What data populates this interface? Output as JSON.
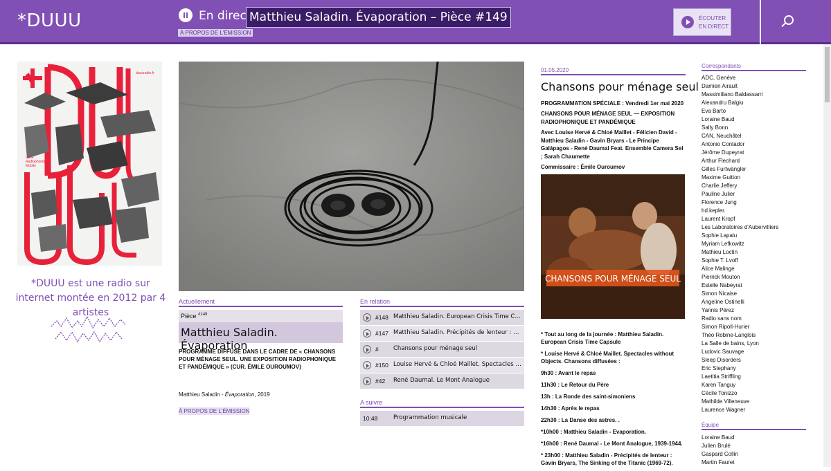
{
  "header": {
    "logo": "*DUUU",
    "live_label": "En direct :",
    "live_title": "Matthieu Saladin. Évaporation – Pièce #149",
    "about_link": "À PROPOS DE L'ÉMISSION",
    "listen_line1": "ÉCOUTER",
    "listen_line2": "EN DIRECT",
    "accent_color": "#8150b4"
  },
  "left": {
    "poster_label": "duuuradio.fr",
    "poster_caption_1": "Unité",
    "poster_caption_2": "Radiophonique",
    "poster_caption_3": "Mobile",
    "tagline": "*DUUU est une radio sur internet montée en 2012 par 4 artistes"
  },
  "current": {
    "section": "Actuellement",
    "piece_label": "Pièce ",
    "piece_number": "#149",
    "title": "Matthieu Saladin. Évaporation",
    "program_text": "PROGRAMME DIFFUSÉ DANS LE CADRE DE « CHANSONS POUR MÉNAGE SEUL. UNE EXPOSITION RADIOPHONIQUE ET PANDÉMIQUE » (CUR. ÉMILE OUROUMOV)",
    "credit_author": "Matthieu Saladin - ",
    "credit_work": "Évaporation",
    "credit_year": ", 2019",
    "about_link": "À PROPOS DE L'ÉMISSION"
  },
  "related": {
    "section": "En relation",
    "items": [
      {
        "num": "#148",
        "title": "Matthieu Saladin. European Crisis Time Capsule"
      },
      {
        "num": "#147",
        "title": "Matthieu Saladin. Précipités de lenteur : Gavin Br..."
      },
      {
        "num": "#",
        "title": "Chansons pour ménage seul"
      },
      {
        "num": "#150",
        "title": "Louise Hervé & Chloé Maillet. Spectacles without..."
      },
      {
        "num": "#42",
        "title": "René Daumal. Le Mont Analogue"
      }
    ]
  },
  "next": {
    "section": "A suivre",
    "time": "10:48",
    "title": "Programmation musicale"
  },
  "article": {
    "date": "01.05.2020",
    "title": "Chansons pour ménage seul",
    "line1": "PROGRAMMATION SPÉCIALE : Vendredi 1er mai 2020",
    "line2": "CHANSONS POUR MÉNAGE SEUL — EXPOSITION RADIOPHONIQUE ET PANDÉMIQUE",
    "line3": "Avec Louise Hervé & Chloé Maillet - Félicien David - Matthieu Saladin - Gavin Bryars - Le Principe Galápagos - René Daumal Feat. Ensemble Camera Sel ; Sarah Chaumette",
    "line4": "Commissaire : Émile Ouroumov",
    "cover_text": "CHANSONS POUR MÉNAGE SEUL",
    "schedule": [
      "* Tout au long de la journée : Matthieu Saladin. European Crisis Time Capsule",
      "* Louise Hervé & Chloé Maillet. Spectacles without Objects. Chansons diffusées :",
      "9h30 : Avant le repas",
      "11h30 : Le Retour du Père",
      "13h : La Ronde des saint-simoniens",
      "14h30 : Après le repas",
      "22h30 : La Danse des astres. .",
      "*10h00 : Matthieu Saladin - Evaporation.",
      "*16h00 : René Daumal - Le Mont Analogue, 1939-1944.",
      "* 23h00 : Matthieu Saladin - Précipités de lenteur : Gavin Bryars, The Sinking of the Titanic (1969-72)."
    ]
  },
  "sidebar": {
    "correspondants_title": "Correspondants",
    "correspondants": [
      "ADC, Genève",
      "Damien Airault",
      "Massimiliano Baldassarri",
      "Alexandru Balgiu",
      "Eva Barto",
      "Loraine Baud",
      "Sally Bonn",
      "CAN, Neuchâtel",
      "Antonio Contador",
      "Jérôme Dupeyrat",
      "Arthur Flechard",
      "Gilles Furtwängler",
      "Maxime Guitton",
      "Charlie Jeffery",
      "Pauline Julier",
      "Florence Jung",
      "hd.kepler.",
      "Laurent Kropf",
      "Les Laboratoires d'Aubervilliers",
      "Sophie Lapalu",
      "Myriam Lefkowitz",
      "Mathieu Loctin",
      "Sophie T. Lvoff",
      "Alice Malinge",
      "Pierrick Mouton",
      "Estelle Nabeyrat",
      "Simon Nicaise",
      "Angeline Ostinelli",
      "Yannis Pérez",
      "Radio sans nom",
      "Simon Ripoll-Hurier",
      "Théo Robine-Langlois",
      "La Salle de bains, Lyon",
      "Ludovic Sauvage",
      "Sleep Disorders",
      "Eric Stephany",
      "Laetitia Striffling",
      "Karen Tanguy",
      "Cécile Tonizzo",
      "Mathilde Villeneuve",
      "Laurence Wagner"
    ],
    "equipe_title": "Équipe",
    "equipe": [
      "Loraine Baud",
      "Julien Brulé",
      "Gaspard Collin",
      "Martin Fauret"
    ]
  }
}
